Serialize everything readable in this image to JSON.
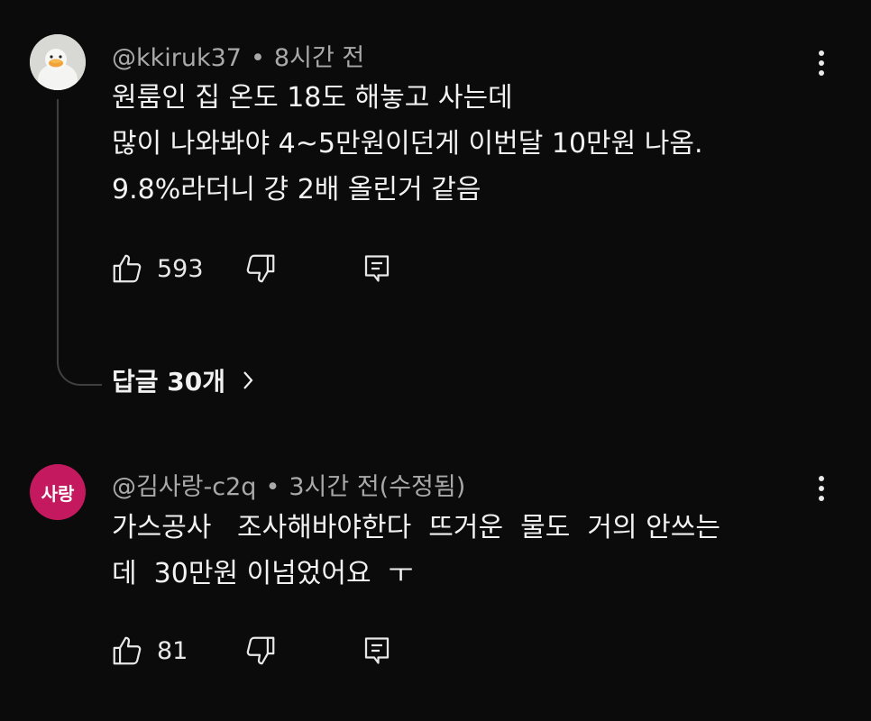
{
  "comments": [
    {
      "author": "@kkiruk37",
      "time": "8시간 전",
      "lines": [
        "원룸인 집 온도 18도 해놓고 사는데",
        "많이 나와봐야 4~5만원이던게 이번달 10만원 나옴.",
        "9.8%라더니 걍 2배 올린거 같음"
      ],
      "likes": "593",
      "replies_label": "답글 30개",
      "avatar_icon": "duck-avatar-icon"
    },
    {
      "author": "@김사랑-c2q",
      "time": "3시간 전(수정됨)",
      "avatar_text": "사랑",
      "avatar_color": "#c4195f",
      "lines": [
        "가스공사   조사해바야한다  뜨거운  물도  거의 안쓰는",
        "데  30만원 이넘었어요  ㅜ"
      ],
      "likes": "81"
    }
  ],
  "icons": [
    "thumbs-up-icon",
    "thumbs-down-icon",
    "reply-comment-icon",
    "more-vert-icon",
    "chevron-right-icon"
  ]
}
